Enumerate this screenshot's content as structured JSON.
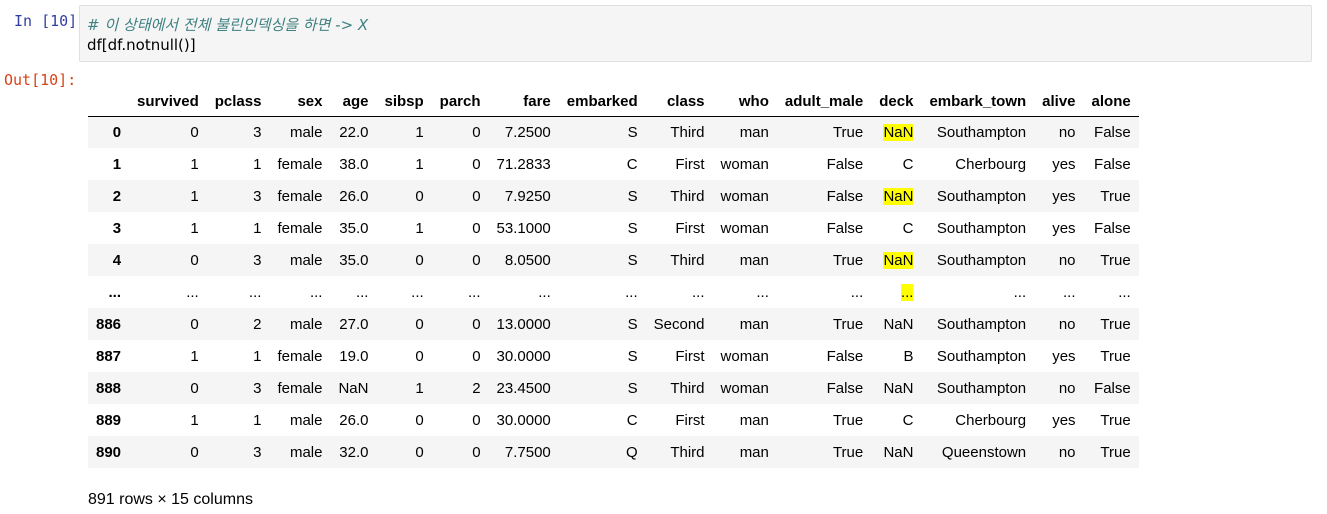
{
  "input_prompt": "In [10]:",
  "output_prompt": "Out[10]:",
  "code": {
    "comment": "# 이 상태에서 전체 불린인덱싱을 하면 -> X",
    "statement": "df[df.notnull()]"
  },
  "table": {
    "columns": [
      "",
      "survived",
      "pclass",
      "sex",
      "age",
      "sibsp",
      "parch",
      "fare",
      "embarked",
      "class",
      "who",
      "adult_male",
      "deck",
      "embark_town",
      "alive",
      "alone"
    ],
    "rows": [
      [
        "0",
        "0",
        "3",
        "male",
        "22.0",
        "1",
        "0",
        "7.2500",
        "S",
        "Third",
        "man",
        "True",
        "NaN",
        "Southampton",
        "no",
        "False"
      ],
      [
        "1",
        "1",
        "1",
        "female",
        "38.0",
        "1",
        "0",
        "71.2833",
        "C",
        "First",
        "woman",
        "False",
        "C",
        "Cherbourg",
        "yes",
        "False"
      ],
      [
        "2",
        "1",
        "3",
        "female",
        "26.0",
        "0",
        "0",
        "7.9250",
        "S",
        "Third",
        "woman",
        "False",
        "NaN",
        "Southampton",
        "yes",
        "True"
      ],
      [
        "3",
        "1",
        "1",
        "female",
        "35.0",
        "1",
        "0",
        "53.1000",
        "S",
        "First",
        "woman",
        "False",
        "C",
        "Southampton",
        "yes",
        "False"
      ],
      [
        "4",
        "0",
        "3",
        "male",
        "35.0",
        "0",
        "0",
        "8.0500",
        "S",
        "Third",
        "man",
        "True",
        "NaN",
        "Southampton",
        "no",
        "True"
      ],
      [
        "...",
        "...",
        "...",
        "...",
        "...",
        "...",
        "...",
        "...",
        "...",
        "...",
        "...",
        "...",
        "...",
        "...",
        "...",
        "..."
      ],
      [
        "886",
        "0",
        "2",
        "male",
        "27.0",
        "0",
        "0",
        "13.0000",
        "S",
        "Second",
        "man",
        "True",
        "NaN",
        "Southampton",
        "no",
        "True"
      ],
      [
        "887",
        "1",
        "1",
        "female",
        "19.0",
        "0",
        "0",
        "30.0000",
        "S",
        "First",
        "woman",
        "False",
        "B",
        "Southampton",
        "yes",
        "True"
      ],
      [
        "888",
        "0",
        "3",
        "female",
        "NaN",
        "1",
        "2",
        "23.4500",
        "S",
        "Third",
        "woman",
        "False",
        "NaN",
        "Southampton",
        "no",
        "False"
      ],
      [
        "889",
        "1",
        "1",
        "male",
        "26.0",
        "0",
        "0",
        "30.0000",
        "C",
        "First",
        "man",
        "True",
        "C",
        "Cherbourg",
        "yes",
        "True"
      ],
      [
        "890",
        "0",
        "3",
        "male",
        "32.0",
        "0",
        "0",
        "7.7500",
        "Q",
        "Third",
        "man",
        "True",
        "NaN",
        "Queenstown",
        "no",
        "True"
      ]
    ],
    "highlighted_cells": [
      [
        0,
        12
      ],
      [
        2,
        12
      ],
      [
        4,
        12
      ],
      [
        5,
        12
      ]
    ],
    "highlight_color": "#ffff00"
  },
  "footer": "891 rows × 15 columns",
  "colors": {
    "input_prompt": "#303f9f",
    "output_prompt": "#d84315",
    "comment": "#408080",
    "cell_background": "#f5f5f5"
  }
}
